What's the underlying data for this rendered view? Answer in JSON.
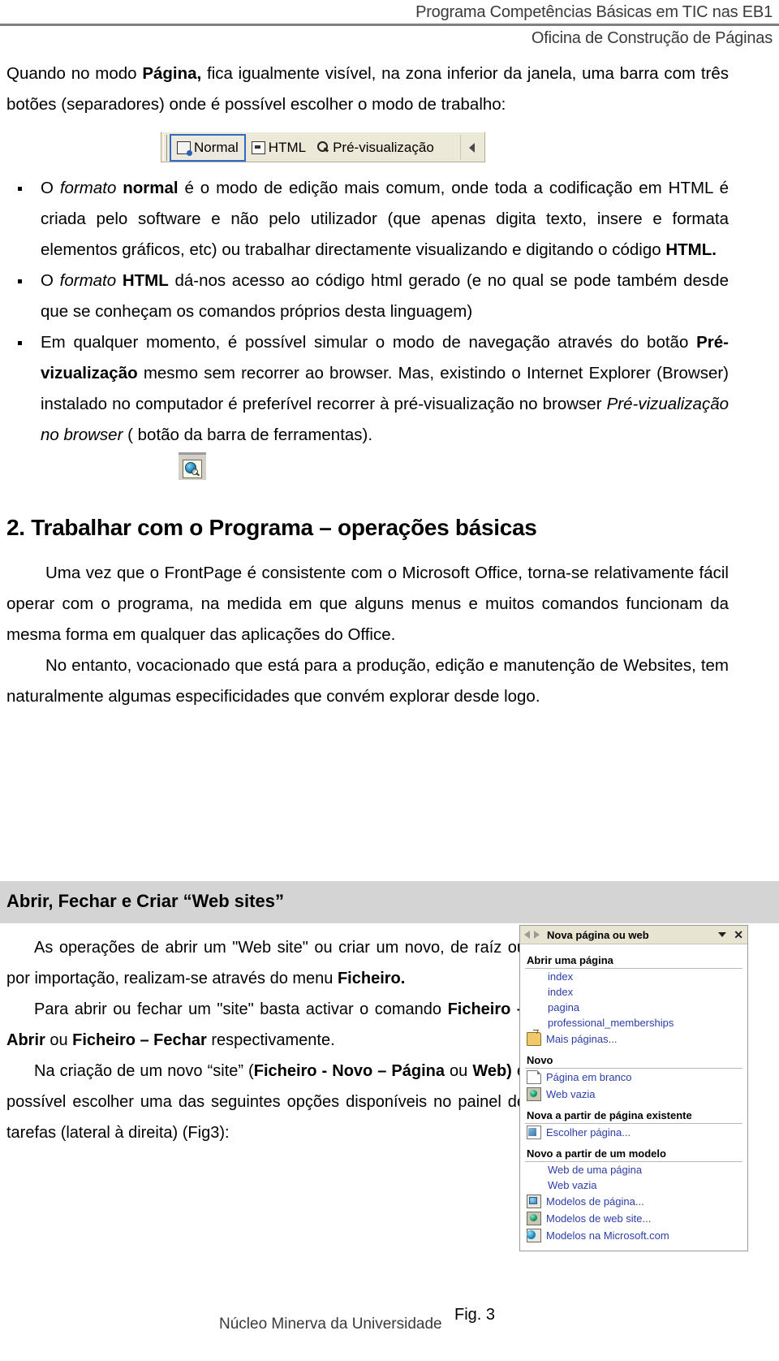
{
  "header": {
    "line1": "Programa Competências Básicas em TIC nas EB1",
    "line2": "Oficina de Construção de Páginas"
  },
  "intro": {
    "p1_pre": "Quando no modo ",
    "p1_bold": "Página,",
    "p1_post": " fica igualmente visível, na zona inferior da janela, uma barra com três botões (separadores) onde é possível escolher o modo de trabalho:"
  },
  "viewbar": {
    "tabs": [
      {
        "label": "Normal",
        "icon": "normal-view-icon",
        "active": true
      },
      {
        "label": "HTML",
        "icon": "html-view-icon",
        "active": false
      },
      {
        "label": "Pré-visualização",
        "icon": "preview-magnifier-icon",
        "active": false
      }
    ],
    "overflow_icon": "triangle-left-icon"
  },
  "bullets": [
    {
      "parts": [
        {
          "t": "O ",
          "s": "n"
        },
        {
          "t": "formato ",
          "s": "i"
        },
        {
          "t": "normal",
          "s": "b"
        },
        {
          "t": " é o modo de edição mais comum, onde toda a codificação em HTML é criada pelo software e não pelo utilizador (que apenas digita texto, insere e formata elementos gráficos, etc) ou trabalhar directamente visualizando e digitando o código ",
          "s": "n"
        },
        {
          "t": "HTML.",
          "s": "b"
        }
      ]
    },
    {
      "parts": [
        {
          "t": "O ",
          "s": "n"
        },
        {
          "t": "formato ",
          "s": "i"
        },
        {
          "t": "HTML",
          "s": "b"
        },
        {
          "t": " dá-nos acesso ao código html gerado (e no qual se pode também desde que se conheçam os comandos próprios desta linguagem)",
          "s": "n"
        }
      ]
    },
    {
      "parts": [
        {
          "t": "Em qualquer momento, é possível simular o modo de navegação através do botão ",
          "s": "n"
        },
        {
          "t": "Pré-vizualização",
          "s": "b"
        },
        {
          "t": " mesmo sem recorrer ao browser. Mas, existindo o Internet Explorer (Browser) instalado no computador é preferível recorrer à pré-visualização no browser ",
          "s": "n"
        },
        {
          "t": "Pré-vizualização no browser",
          "s": "i"
        },
        {
          "t": " ( botão da barra de ferramentas).",
          "s": "n"
        }
      ]
    }
  ],
  "preview_button": {
    "icon": "preview-in-browser-icon"
  },
  "section2": {
    "title": "2. Trabalhar com o Programa – operações básicas",
    "p1": "Uma vez que o FrontPage é consistente com o Microsoft Office, torna-se relativamente fácil operar com o programa, na medida em que alguns menus e muitos comandos funcionam da mesma forma em qualquer das aplicações do Office.",
    "p2": "No entanto, vocacionado que está para a produção, edição e manutenção de Websites, tem naturalmente algumas especificidades que convém explorar desde logo."
  },
  "section3": {
    "band_title": "Abrir, Fechar e Criar “Web sites”",
    "paragraphs": [
      [
        {
          "t": "As operações de abrir um \"Web site\" ou criar um novo, de raíz ou por importação, realizam-se através do menu ",
          "s": "n"
        },
        {
          "t": "Ficheiro.",
          "s": "b"
        }
      ],
      [
        {
          "t": "Para abrir ou fechar um \"site\" basta activar o comando ",
          "s": "n"
        },
        {
          "t": "Ficheiro – Abrir",
          "s": "b"
        },
        {
          "t": " ou ",
          "s": "n"
        },
        {
          "t": "Ficheiro – Fechar",
          "s": "b"
        },
        {
          "t": " respectivamente.",
          "s": "n"
        }
      ],
      [
        {
          "t": "Na criação de um novo “site”  (",
          "s": "n"
        },
        {
          "t": "Ficheiro - Novo – Página",
          "s": "b"
        },
        {
          "t": " ou ",
          "s": "n"
        },
        {
          "t": "Web)",
          "s": "b"
        },
        {
          "t": " é possível  escolher uma das seguintes opções disponíveis no painel de tarefas (lateral à direita) (Fig3):",
          "s": "n"
        }
      ]
    ]
  },
  "taskpane": {
    "title": "Nova página ou web",
    "nav_back_icon": "arrow-left-icon",
    "nav_forward_icon": "arrow-right-icon",
    "menu_caret_icon": "chevron-down-icon",
    "close_icon": "close-icon",
    "groups": [
      {
        "heading": "Abrir uma página",
        "items": [
          {
            "label": "index",
            "icon": null
          },
          {
            "label": "index",
            "icon": null
          },
          {
            "label": "pagina",
            "icon": null
          },
          {
            "label": "professional_memberships",
            "icon": null
          },
          {
            "label": "Mais páginas...",
            "icon": "open-folder-icon"
          }
        ]
      },
      {
        "heading": "Novo",
        "items": [
          {
            "label": "Página em branco",
            "icon": "blank-page-icon"
          },
          {
            "label": "Web vazia",
            "icon": "empty-web-icon"
          }
        ]
      },
      {
        "heading": "Nova a partir de página existente",
        "items": [
          {
            "label": "Escolher página...",
            "icon": "choose-page-icon"
          }
        ]
      },
      {
        "heading": "Novo a partir de um modelo",
        "items": [
          {
            "label": "Web de uma página",
            "icon": null
          },
          {
            "label": "Web vazia",
            "icon": null
          },
          {
            "label": "Modelos de página...",
            "icon": "page-templates-icon"
          },
          {
            "label": "Modelos de web site...",
            "icon": "website-templates-icon"
          },
          {
            "label": "Modelos na Microsoft.com",
            "icon": "microsoft-templates-icon"
          }
        ]
      }
    ]
  },
  "footer": {
    "left": "Núcleo Minerva da Universidade",
    "figure": "Fig. 3"
  }
}
